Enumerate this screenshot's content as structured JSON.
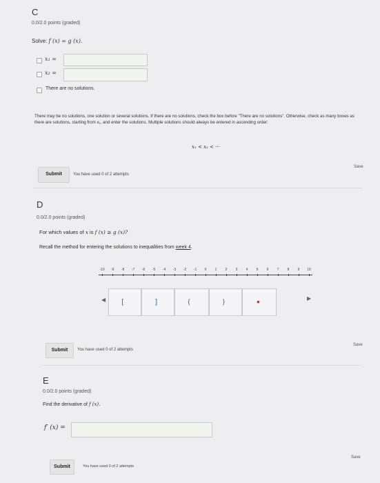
{
  "sectionC": {
    "letter": "C",
    "points": "0.0/2.0 points (graded)",
    "solve_prefix": "Solve:",
    "solve_eq": "f (x) = g (x).",
    "options": [
      {
        "label": "x₁ ="
      },
      {
        "label": "x₂ ="
      },
      {
        "label": "There are no solutions."
      }
    ],
    "instructions": "There may be no solutions, one solution or several solutions. If there are no solutions, check the box before \"There are no solutions\". Otherwise, check as many boxes as there are solutions, starting from x₁, and enter the solutions. Multiple solutions should always be entered in ascending order:",
    "ordering": "x₁ < x₂ < ···",
    "save": "Save",
    "submit": "Submit",
    "attempts": "You have used 0 of 2 attempts"
  },
  "sectionD": {
    "letter": "D",
    "points": "0.0/2.0 points (graded)",
    "question_prefix": "For which values of",
    "question_var": "x",
    "question_mid": "is",
    "question_ineq": "f (x) ≥ g (x)?",
    "recall_text": "Recall the method for entering the solutions to inequalities from",
    "recall_link": "week 4",
    "recall_end": ".",
    "number_line": {
      "ticks": [
        "-10",
        "-9",
        "-8",
        "-7",
        "-6",
        "-5",
        "-4",
        "-3",
        "-2",
        "-1",
        "0",
        "1",
        "2",
        "3",
        "4",
        "5",
        "6",
        "7",
        "8",
        "9",
        "10"
      ],
      "buttons": [
        "[",
        "]",
        "(",
        ")",
        "•"
      ]
    },
    "save": "Save",
    "submit": "Submit",
    "attempts": "You have used 0 of 2 attempts"
  },
  "sectionE": {
    "letter": "E",
    "points": "0.0/2.0 points (graded)",
    "question_prefix": "Find the derivative of",
    "question_func": "f (x).",
    "input_label": "f′ (x) =",
    "save": "Save",
    "submit": "Submit",
    "attempts": "You have used 0 of 2 attempts"
  }
}
